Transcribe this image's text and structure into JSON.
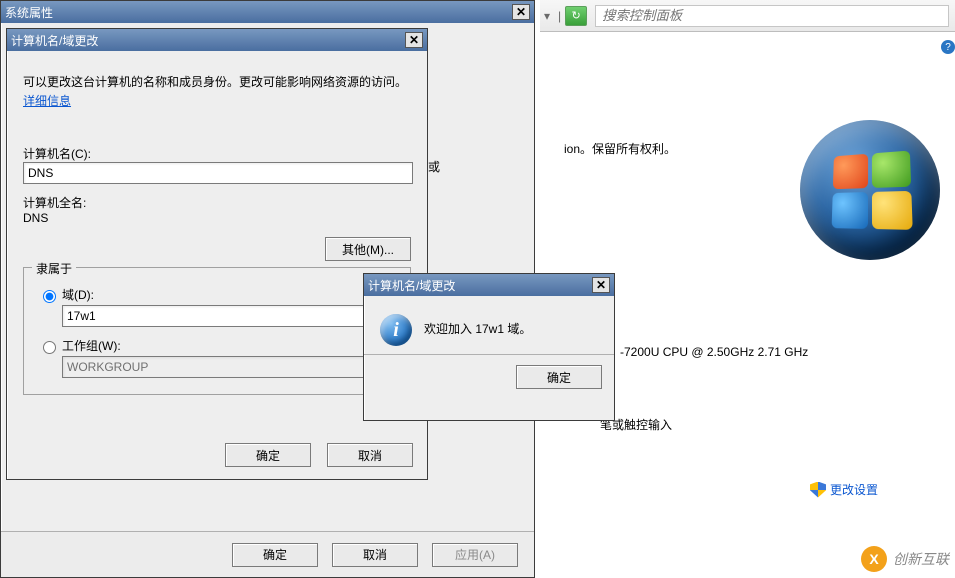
{
  "cpanel": {
    "search_placeholder": "搜索控制面板",
    "rights": "ion。保留所有权利。",
    "cpu": "-7200U CPU @ 2.50GHz    2.71 GHz",
    "input_device": "笔或触控输入",
    "change_settings": "更改设置",
    "help_badge": "?",
    "truncated_wu": "或"
  },
  "sysprops": {
    "title": "系统属性",
    "ok": "确定",
    "cancel": "取消",
    "apply": "应用(A)"
  },
  "namedlg": {
    "title": "计算机名/域更改",
    "desc_a": "可以更改这台计算机的名称和成员身份。更改可能影响网络资源的访问。",
    "more_info": "详细信息",
    "label_name": "计算机名(C):",
    "name_value": "DNS",
    "label_full": "计算机全名:",
    "full_value": "DNS",
    "btn_other": "其他(M)...",
    "group_legend": "隶属于",
    "radio_domain": "域(D):",
    "domain_value": "17w1",
    "radio_workgroup": "工作组(W):",
    "workgroup_value": "WORKGROUP",
    "ok": "确定",
    "cancel": "取消"
  },
  "msgbox": {
    "title": "计算机名/域更改",
    "text": "欢迎加入 17w1 域。",
    "ok": "确定"
  },
  "watermark": {
    "brand": "创新互联",
    "x": "X"
  }
}
